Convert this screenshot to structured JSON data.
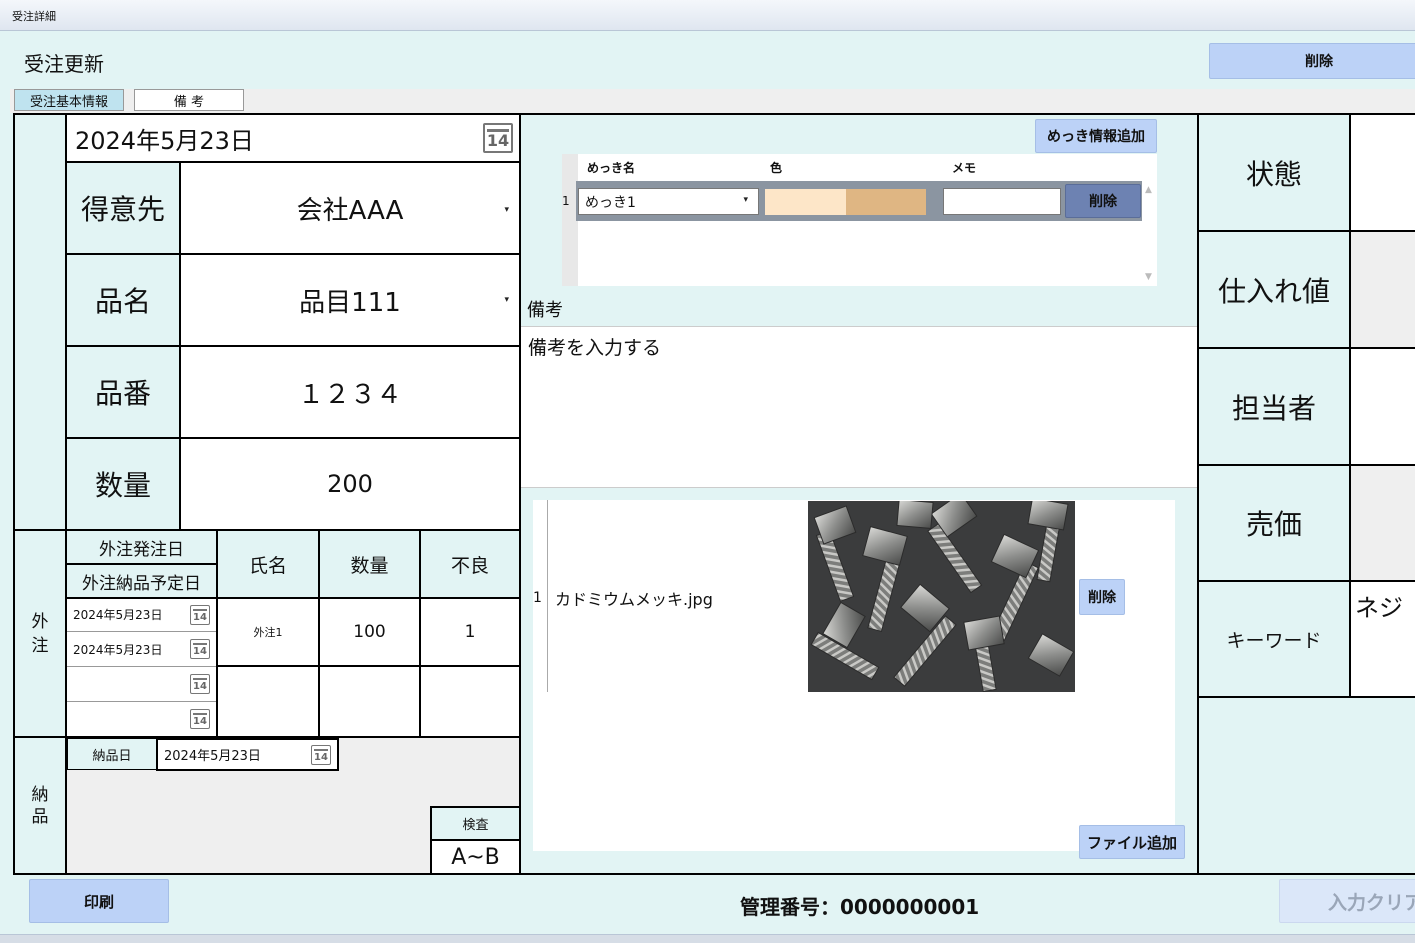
{
  "window": {
    "title": "受注詳細"
  },
  "header": {
    "title": "受注更新",
    "delete_label": "削除"
  },
  "tabs": [
    {
      "label": "受注基本情報"
    },
    {
      "label": "備 考"
    }
  ],
  "basic": {
    "date": "2024年5月23日",
    "customer_label": "得意先",
    "customer_value": "会社AAA",
    "product_label": "品名",
    "product_value": "品目111",
    "product_no_label": "品番",
    "product_no_value": "１２３４",
    "quantity_label": "数量",
    "quantity_value": "200"
  },
  "outsource": {
    "side_label": "外\n注",
    "order_date_header": "外注発注日",
    "delivery_date_header": "外注納品予定日",
    "name_header": "氏名",
    "qty_header": "数量",
    "defect_header": "不良",
    "order_date": "2024年5月23日",
    "delivery_date": "2024年5月23日",
    "name": "外注1",
    "qty": "100",
    "defect": "1"
  },
  "delivery": {
    "side_label": "納\n品",
    "date_label": "納品日",
    "date_value": "2024年5月23日",
    "inspection_label": "検査",
    "inspection_value": "A~B"
  },
  "plating": {
    "add_label": "めっき情報追加",
    "col_name": "めっき名",
    "col_color": "色",
    "col_memo": "メモ",
    "row_no": "1",
    "row_name": "めっき1",
    "row_delete": "削除",
    "color_light": "#fde6c8",
    "color_dark": "#dfb683"
  },
  "remarks": {
    "label": "備考",
    "placeholder": "備考を入力する"
  },
  "files": {
    "row_no": "1",
    "file_name": "カドミウムメッキ.jpg",
    "delete_label": "削除",
    "add_label": "ファイル追加"
  },
  "right_panel": {
    "status_label": "状態",
    "cost_label": "仕入れ値",
    "staff_label": "担当者",
    "price_label": "売価",
    "keyword_label": "キーワード",
    "keyword_value": "ネジ"
  },
  "footer": {
    "print_label": "印刷",
    "management_no": "管理番号：0000000001",
    "clear_label": "入力クリア"
  },
  "calendar_icon_day": "14"
}
